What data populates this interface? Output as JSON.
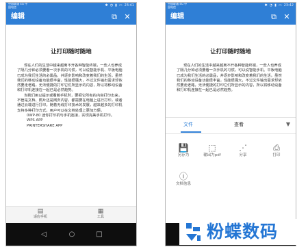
{
  "colors": {
    "brand_blue": "#2f7fd6",
    "nav_black": "#0e0e0e",
    "watermark_blue": "#2476d4"
  },
  "status_bar": {
    "carrier": "中国联通 4G\n中国电信",
    "left_time": "23:41",
    "right_time": "23:42",
    "icons": [
      "bluetooth-icon",
      "vibrate-icon",
      "wifi-icon",
      "signal-icon",
      "battery-icon"
    ]
  },
  "app": {
    "title": "编辑",
    "header_icons": [
      "layers-icon",
      "close-icon"
    ]
  },
  "document": {
    "title": "让打印随时随地",
    "paragraphs": [
      "现在人们的生活中越来越离不开各种智能终端，一些人也养成了隔几分钟必须要看一次手机的习惯，可以说智能手机、平板电脑已成为我们生活的必需品，并逐步影响和改变着我们的生活。虽然我们的移动设备功能很丰富，性能很强大，不过文件输出需求却依然要走老路，无法便捷的打印它们所显示的内容，所以将移动设备和打印机连接在一起已是必然趋势。",
      "当我们用以提示或看着手机时，要把它所有的内容打印出来，不管是文档、照片还是网页内容，都需要在电脑上进行打印，或者通过云端进行打印。随着无线打印技术的发展，越来越多的打印机支持多种打印方式，用户可以在文档处理上更加方便。",
      "0WP-80 迷你打印机与手机连接，实现完美手机打印。",
      "WPS APP",
      "PRINTERSHARE APP"
    ]
  },
  "bottom_tools": [
    {
      "label": "适应手机",
      "icon": "fit-screen-icon"
    },
    {
      "label": "工具",
      "icon": "tools-grid-icon"
    }
  ],
  "nav": [
    "back-icon",
    "home-icon",
    "recents-icon"
  ],
  "share_sheet": {
    "tabs": [
      "文件",
      "查看"
    ],
    "active_tab": "文件",
    "actions": [
      {
        "label": "另存为",
        "icon": "save-as-icon"
      },
      {
        "label": "输出为pdf",
        "icon": "export-pdf-icon"
      },
      {
        "label": "分享",
        "icon": "share-icon"
      },
      {
        "label": "打印",
        "icon": "print-icon"
      },
      {
        "label": "文档信息",
        "icon": "info-icon"
      }
    ]
  },
  "watermark": {
    "text": "粉蝶数码"
  }
}
